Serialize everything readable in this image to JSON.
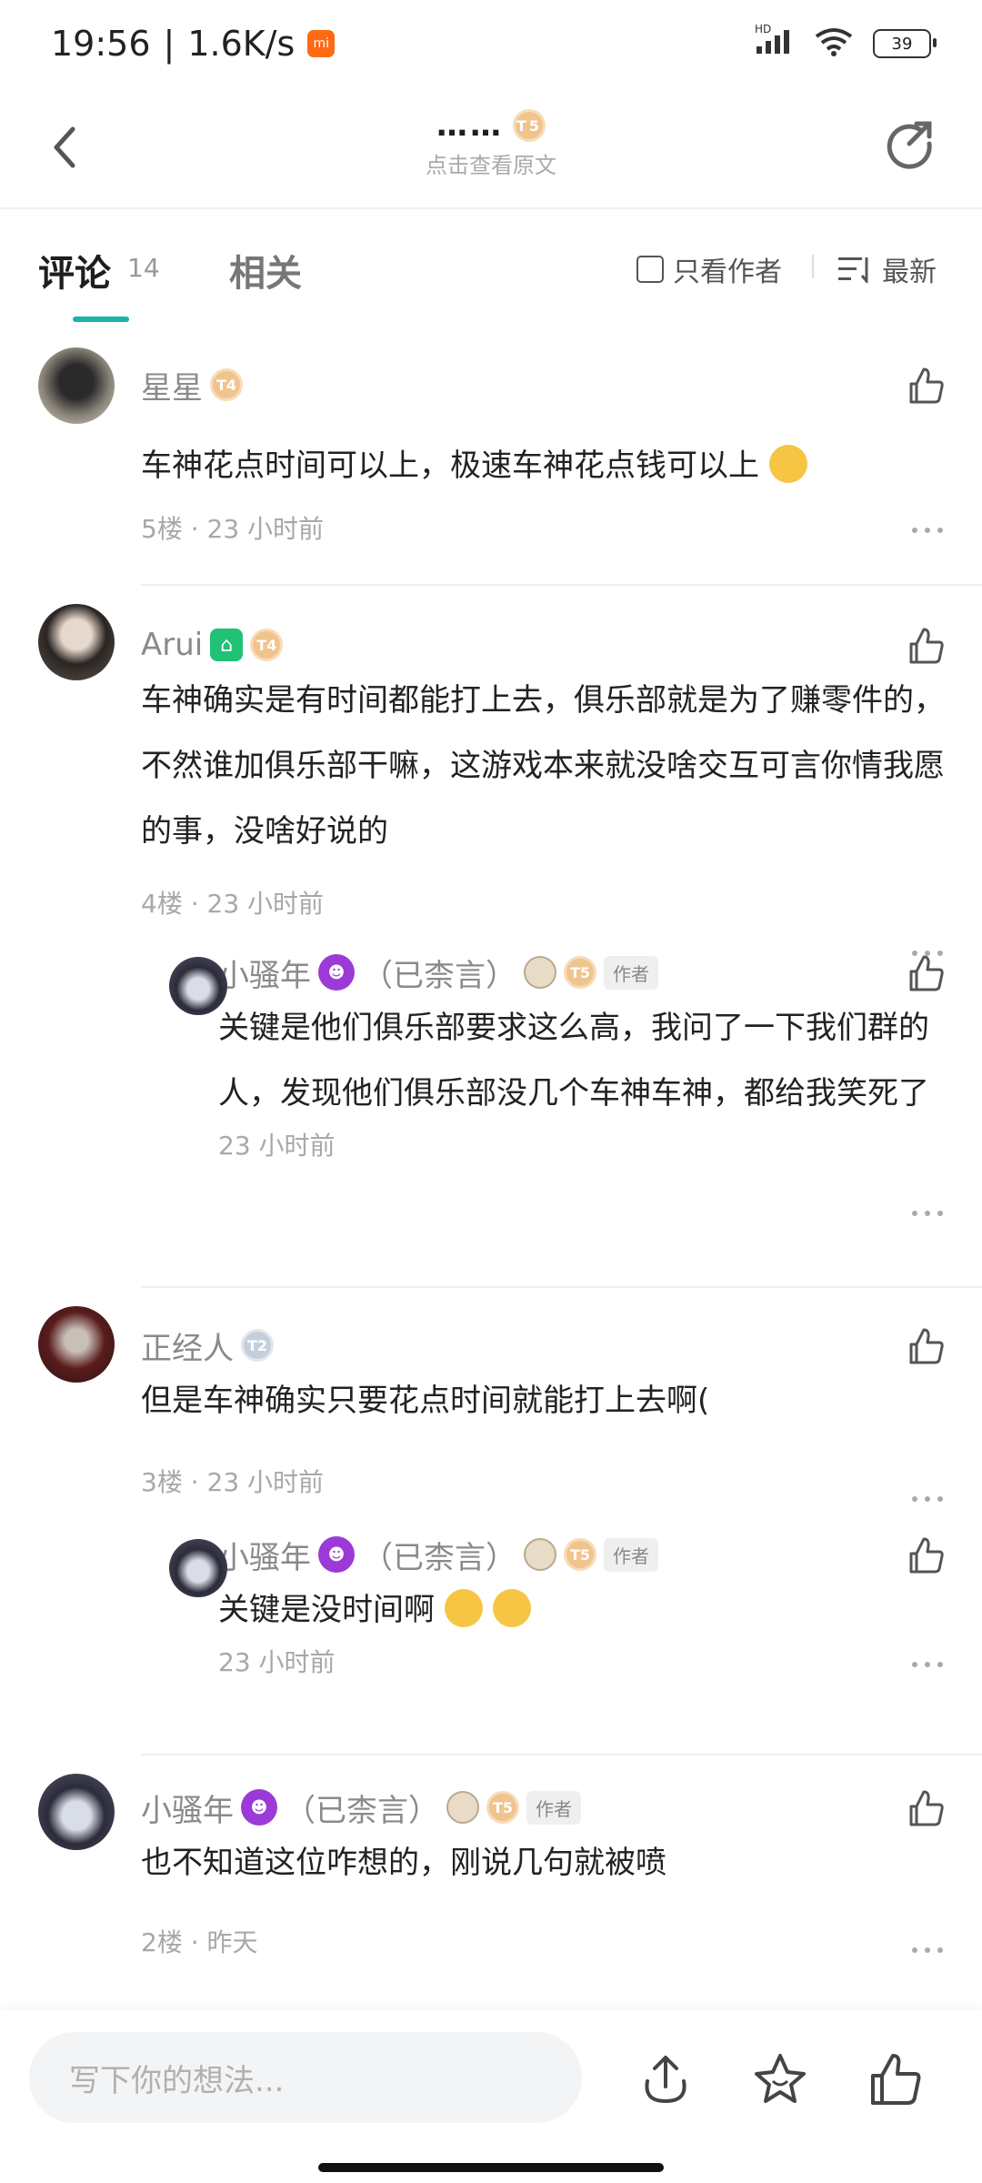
{
  "status": {
    "time": "19:56",
    "speed": "1.6K/s",
    "mi": "mi",
    "hd": "HD",
    "battery": "39"
  },
  "header": {
    "title": "……",
    "subtitle": "点击查看原文",
    "level": "T5"
  },
  "tabs": {
    "comments_label": "评论",
    "comments_count": "14",
    "related_label": "相关",
    "only_author": "只看作者",
    "sort_label": "最新"
  },
  "comments": [
    {
      "name": "星星",
      "level": "T4",
      "text": "车神花点时间可以上，极速车神花点钱可以上",
      "meta": "5楼 · 23 小时前"
    },
    {
      "name": "Arui",
      "level": "T4",
      "text": "车神确实是有时间都能打上去，俱乐部就是为了赚零件的，不然谁加俱乐部干嘛，这游戏本来就没啥交互可言你情我愿的事，没啥好说的",
      "meta": "4楼 · 23 小时前",
      "reply": {
        "name": "小骚年",
        "suffix": "（已柰言）",
        "level": "T5",
        "tag": "作者",
        "text": "关键是他们俱乐部要求这么高，我问了一下我们群的人，发现他们俱乐部没几个车神车神，都给我笑死了",
        "meta": "23 小时前"
      }
    },
    {
      "name": "正经人",
      "level": "T2",
      "text": "但是车神确实只要花点时间就能打上去啊(",
      "meta": "3楼 · 23 小时前",
      "reply": {
        "name": "小骚年",
        "suffix": "（已柰言）",
        "level": "T5",
        "tag": "作者",
        "text": "关键是没时间啊",
        "meta": "23 小时前"
      }
    },
    {
      "name": "小骚年",
      "suffix": "（已柰言）",
      "level": "T5",
      "tag": "作者",
      "text": "也不知道这位咋想的，刚说几句就被喷",
      "meta": "2楼 · 昨天"
    }
  ],
  "bottom": {
    "placeholder": "写下你的想法..."
  }
}
